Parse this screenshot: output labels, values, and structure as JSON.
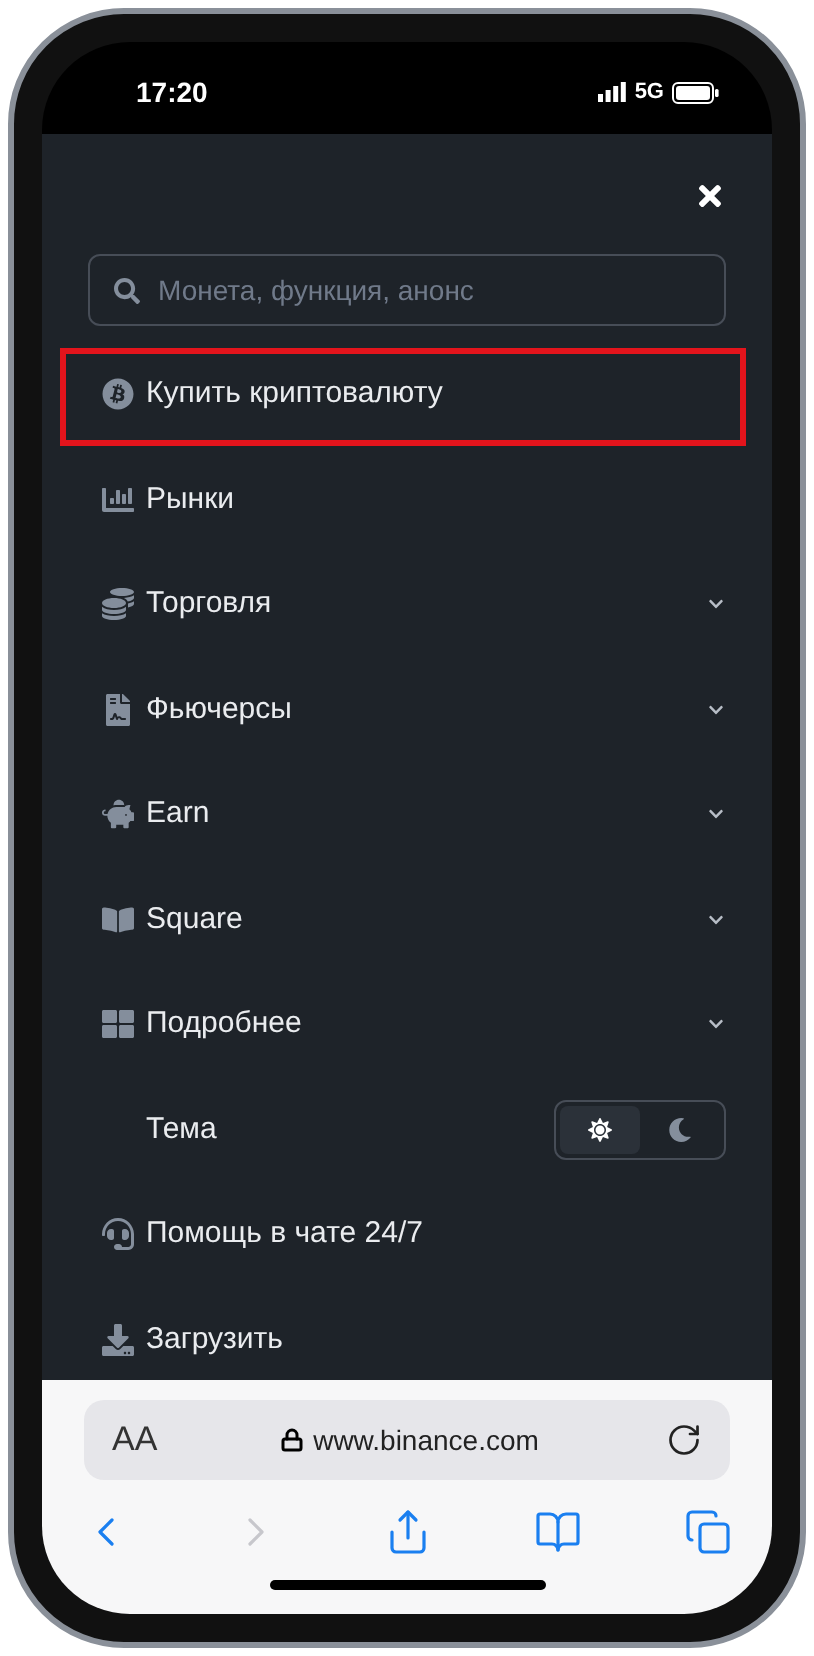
{
  "status_bar": {
    "time": "17:20",
    "network": "5G"
  },
  "search": {
    "placeholder": "Монета, функция, анонс"
  },
  "menu": [
    {
      "label": "Купить криптовалюту",
      "expandable": false,
      "highlighted": true
    },
    {
      "label": "Рынки",
      "expandable": false,
      "highlighted": false
    },
    {
      "label": "Торговля",
      "expandable": true,
      "highlighted": false
    },
    {
      "label": "Фьючерсы",
      "expandable": true,
      "highlighted": false
    },
    {
      "label": "Earn",
      "expandable": true,
      "highlighted": false
    },
    {
      "label": "Square",
      "expandable": true,
      "highlighted": false
    },
    {
      "label": "Подробнее",
      "expandable": true,
      "highlighted": false
    }
  ],
  "theme": {
    "label": "Тема",
    "options": [
      {
        "kind": "light",
        "selected": true
      },
      {
        "kind": "dark",
        "selected": false
      }
    ]
  },
  "menu_bottom": [
    {
      "label": "Помощь в чате 24/7",
      "expandable": false,
      "highlighted": false
    },
    {
      "label": "Загрузить",
      "expandable": false,
      "highlighted": false
    }
  ],
  "browser": {
    "text_size": "AA",
    "url": "www.binance.com",
    "toolbar": [
      {
        "kind": "back",
        "disabled": false
      },
      {
        "kind": "forward",
        "disabled": true
      },
      {
        "kind": "share",
        "disabled": false
      },
      {
        "kind": "bookmarks",
        "disabled": false
      },
      {
        "kind": "tabs",
        "disabled": false
      }
    ]
  }
}
